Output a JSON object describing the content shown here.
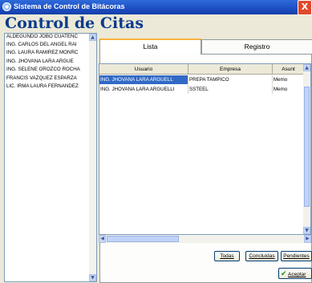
{
  "window": {
    "title": "Sistema de Control de Bitácoras",
    "close_glyph": "X"
  },
  "heading": "Control de Citas",
  "left_list": {
    "items": [
      "ALDEGUNDO JOBO CUATENC",
      "ING. CARLOS DEL ANGEL RAI",
      "ING. LAURA RAMIREZ MONRC",
      "ING. JHOVANA LARA ARGUE",
      "ING. SELENE OROZCO ROCHA",
      "FRANCIS VAZQUEZ ESPARZA",
      "LIC. IRMA LAURA FERNANDEZ"
    ]
  },
  "tabs": [
    {
      "label": "Lista",
      "active": true
    },
    {
      "label": "Registro",
      "active": false
    }
  ],
  "grid": {
    "columns": [
      "Usuario",
      "Empresa",
      "Asunt"
    ],
    "rows": [
      {
        "usuario": "ING. JHOVANA LARA ARGUELL",
        "empresa": "PREPA TAMPICO",
        "asunto": "Memo"
      },
      {
        "usuario": "ING. JHOVANA LARA ARGUELLI",
        "empresa": "SSTEEL",
        "asunto": "Memo"
      }
    ]
  },
  "buttons": {
    "todas": "Todas",
    "concluidas": "Concluidas",
    "pendientes": "Pendientes",
    "aceptar": "Aceptar"
  },
  "icons": {
    "scroll_up": "▲",
    "scroll_down": "▼",
    "scroll_left": "◀",
    "scroll_right": "▶",
    "check": "✔"
  },
  "colors": {
    "title_bar": "#1c4ec3",
    "heading": "#0b3b8c",
    "selection": "#316ac5",
    "close": "#e0492a",
    "tab_accent": "#f9b23c"
  }
}
